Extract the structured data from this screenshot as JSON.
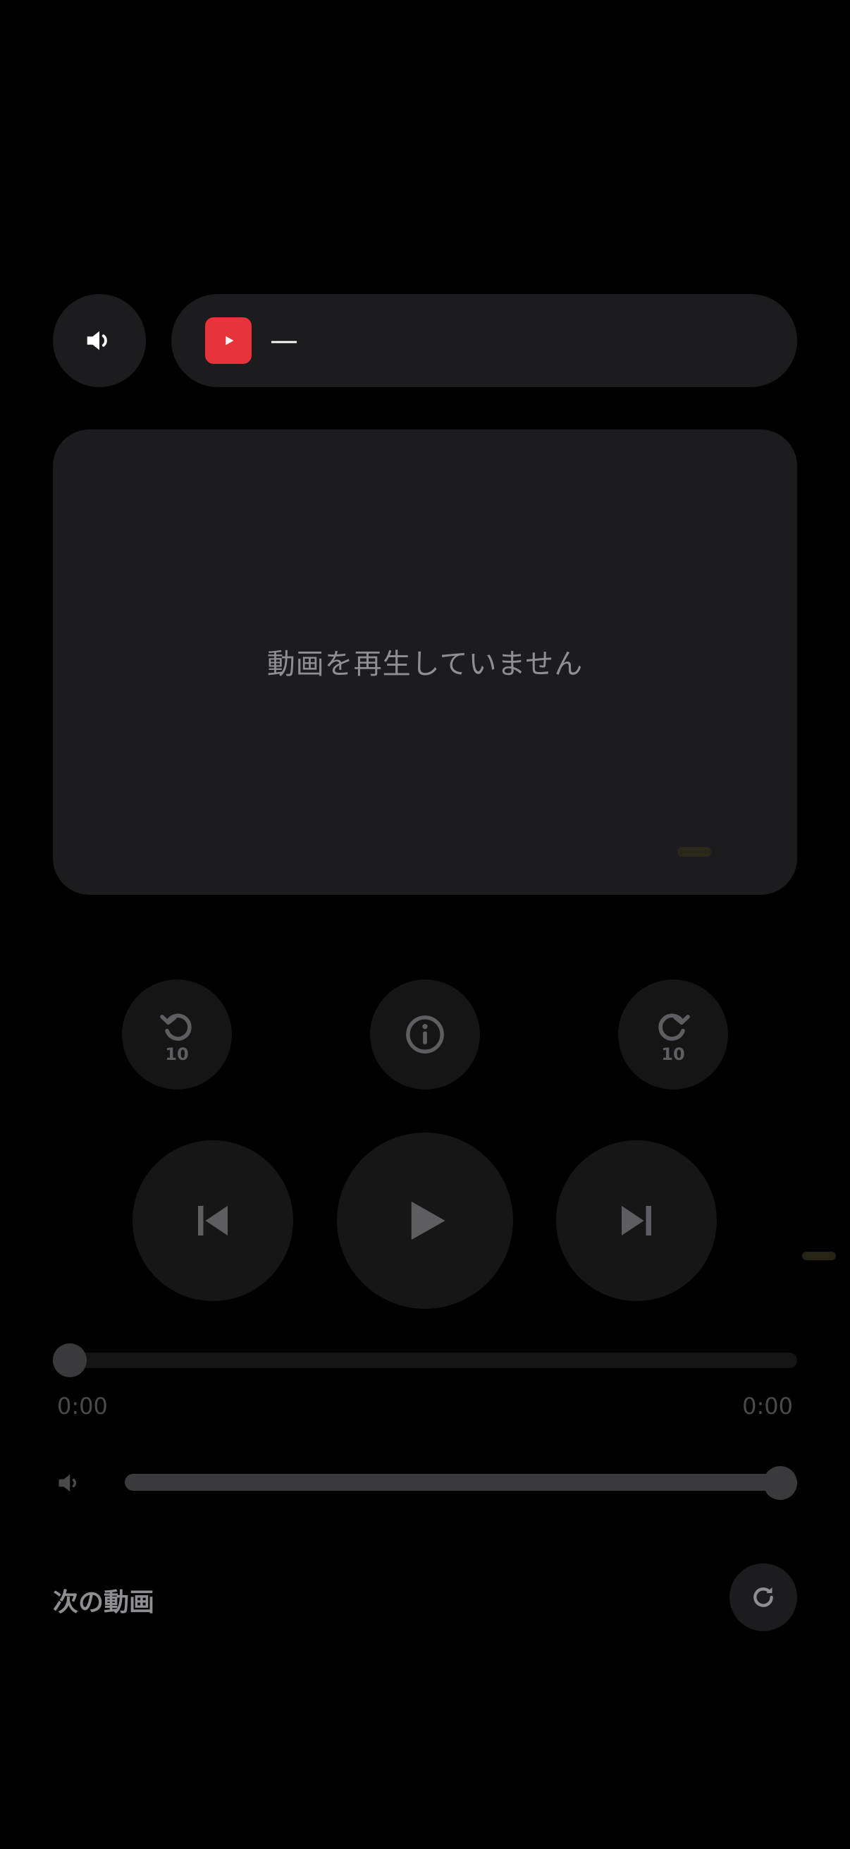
{
  "header": {
    "now_playing_title": "—",
    "source_icon": "youtube-play-icon",
    "sound_icon": "speaker-icon"
  },
  "player": {
    "status_text": "動画を再生していません"
  },
  "controls": {
    "rewind_seconds": "10",
    "forward_seconds": "10",
    "rewind_icon": "rewind-10-icon",
    "info_icon": "info-icon",
    "forward_icon": "forward-10-icon",
    "previous_icon": "skip-previous-icon",
    "play_icon": "play-icon",
    "next_icon": "skip-next-icon"
  },
  "progress": {
    "current_time": "0:00",
    "total_time": "0:00",
    "fraction": 0
  },
  "volume": {
    "level_fraction": 1.0,
    "icon": "volume-icon"
  },
  "up_next": {
    "label": "次の動画",
    "refresh_icon": "refresh-icon"
  },
  "colors": {
    "background": "#000000",
    "surface": "#1c1c1e",
    "accent_red": "#e8323c",
    "muted_text": "#8e8e93"
  }
}
